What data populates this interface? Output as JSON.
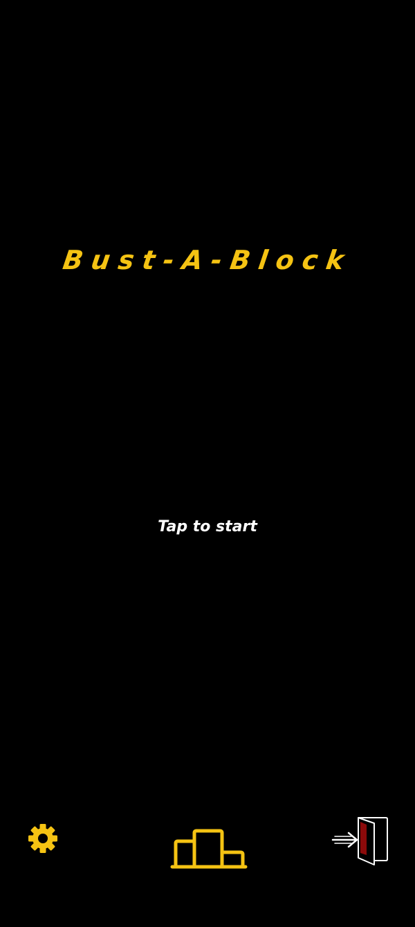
{
  "game": {
    "title": "Bust-A-Block",
    "prompt": "Tap to start"
  },
  "icons": {
    "settings": "gear-icon",
    "leaderboard": "podium-icon",
    "exit": "exit-door-icon"
  },
  "colors": {
    "background": "#000000",
    "accent": "#F5C313",
    "prompt_text": "#FFFFFF",
    "exit_door_fill": "#8B0A0A"
  }
}
